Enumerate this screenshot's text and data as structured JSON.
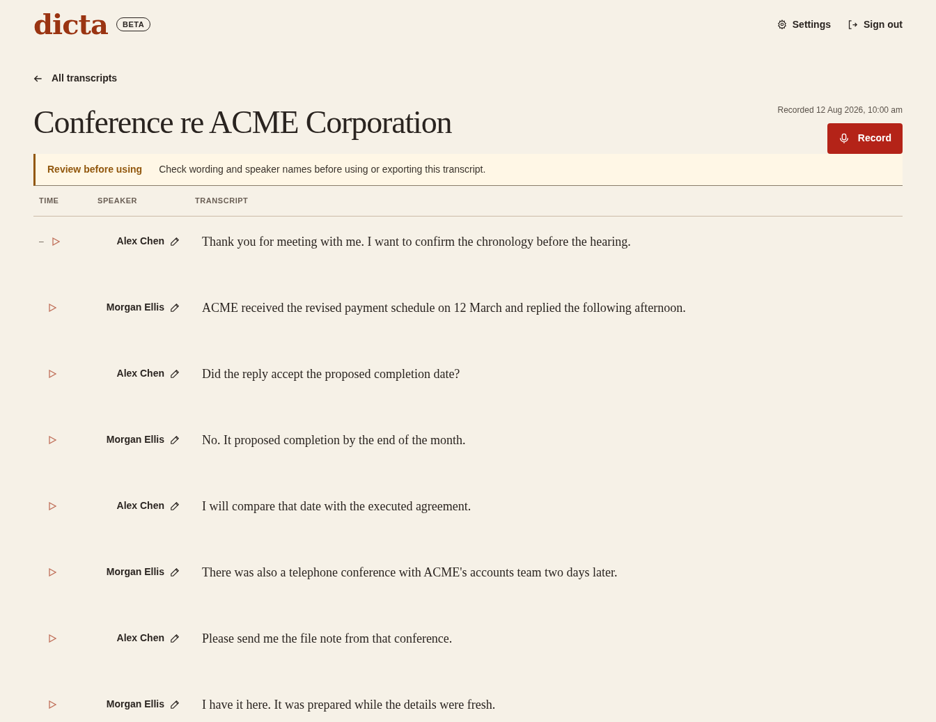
{
  "header": {
    "logo": "dicta",
    "badge": "BETA",
    "nav": [
      {
        "kind": "settings",
        "label": "Settings"
      },
      {
        "kind": "signout",
        "label": "Sign out"
      }
    ]
  },
  "back_link": "All transcripts",
  "title": "Conference re ACME Corporation",
  "recorded": "Recorded 12 Aug 2026, 10:00 am",
  "record_button": "Record",
  "notice": {
    "title": "Review before using",
    "text": "Check wording and speaker names before using or exporting this transcript."
  },
  "table": {
    "columns": [
      "TIME",
      "SPEAKER",
      "TRANSCRIPT"
    ],
    "rows": [
      {
        "time": "–",
        "speaker": "Alex Chen",
        "text": "Thank you for meeting with me. I want to confirm the chronology before the hearing."
      },
      {
        "speaker": "Morgan Ellis",
        "text": "ACME received the revised payment schedule on 12 March and replied the following afternoon."
      },
      {
        "speaker": "Alex Chen",
        "text": "Did the reply accept the proposed completion date?"
      },
      {
        "speaker": "Morgan Ellis",
        "text": "No. It proposed completion by the end of the month."
      },
      {
        "speaker": "Alex Chen",
        "text": "I will compare that date with the executed agreement."
      },
      {
        "speaker": "Morgan Ellis",
        "text": "There was also a telephone conference with ACME's accounts team two days later."
      },
      {
        "speaker": "Alex Chen",
        "text": "Please send me the file note from that conference."
      },
      {
        "speaker": "Morgan Ellis",
        "text": "I have it here. It was prepared while the details were fresh."
      }
    ]
  }
}
